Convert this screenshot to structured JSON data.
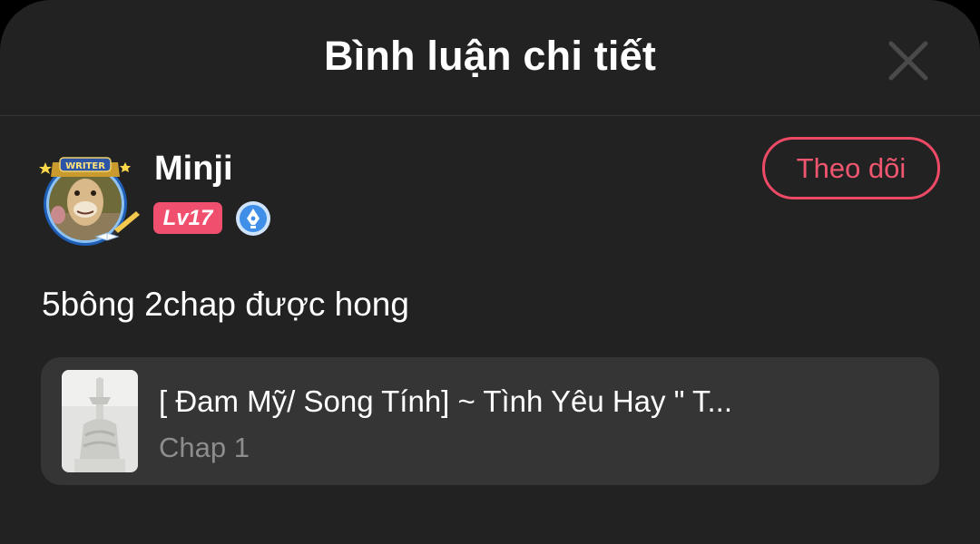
{
  "header": {
    "title": "Bình luận chi tiết",
    "close_icon": "close-icon"
  },
  "comment": {
    "author": {
      "name": "Minji",
      "level": "Lv17",
      "avatar_frame_label": "WRITER",
      "verified_icon": "pen-nib-badge-icon"
    },
    "follow_label": "Theo dõi",
    "text": "5bông 2chap được hong"
  },
  "story": {
    "title": "[ Đam Mỹ/ Song Tính] ~ Tình Yêu Hay \" T...",
    "chapter": "Chap 1"
  },
  "colors": {
    "background": "#222222",
    "card": "#353535",
    "accent": "#f0506e",
    "badge_blue": "#3f8ee8",
    "muted_text": "#8d8d8d"
  }
}
